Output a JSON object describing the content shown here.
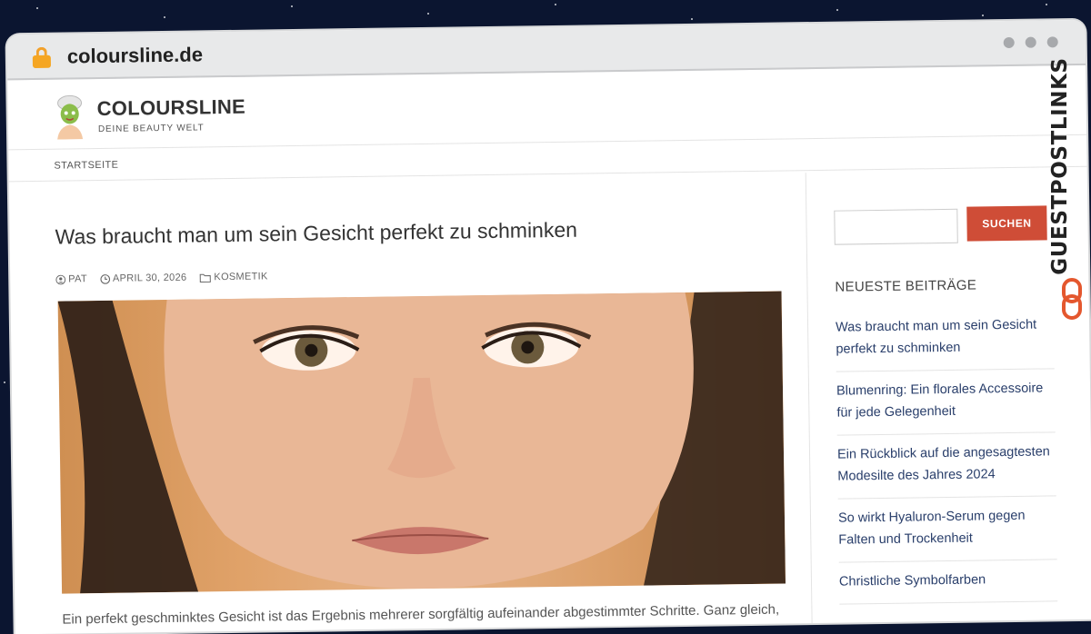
{
  "browser": {
    "url": "coloursline.de"
  },
  "site": {
    "title": "COLOURSLINE",
    "tagline": "DEINE BEAUTY WELT"
  },
  "nav": {
    "items": [
      {
        "label": "STARTSEITE"
      }
    ]
  },
  "post": {
    "title": "Was braucht man um sein Gesicht perfekt zu schminken",
    "author": "PAT",
    "date": "APRIL 30, 2026",
    "category": "KOSMETIK",
    "excerpt": "Ein perfekt geschminktes Gesicht ist das Ergebnis mehrerer sorgfältig aufeinander abgestimmter Schritte. Ganz gleich,"
  },
  "sidebar": {
    "search_button": "SUCHEN",
    "search_placeholder": "",
    "recent_title": "NEUESTE BEITRÄGE",
    "recent_posts": [
      {
        "label": "Was braucht man um sein Gesicht perfekt zu schminken"
      },
      {
        "label": "Blumenring: Ein florales Accessoire für jede Gelegenheit"
      },
      {
        "label": "Ein Rückblick auf die angesagtesten Modesilte des Jahres 2024"
      },
      {
        "label": "So wirkt Hyaluron-Serum gegen Falten und Trockenheit"
      },
      {
        "label": "Christliche Symbolfarben"
      }
    ]
  },
  "watermark": {
    "text": "GUESTPOSTLINKS"
  },
  "colors": {
    "accent": "#cf4d37",
    "link": "#2a3f6b",
    "lock": "#f5a623"
  }
}
